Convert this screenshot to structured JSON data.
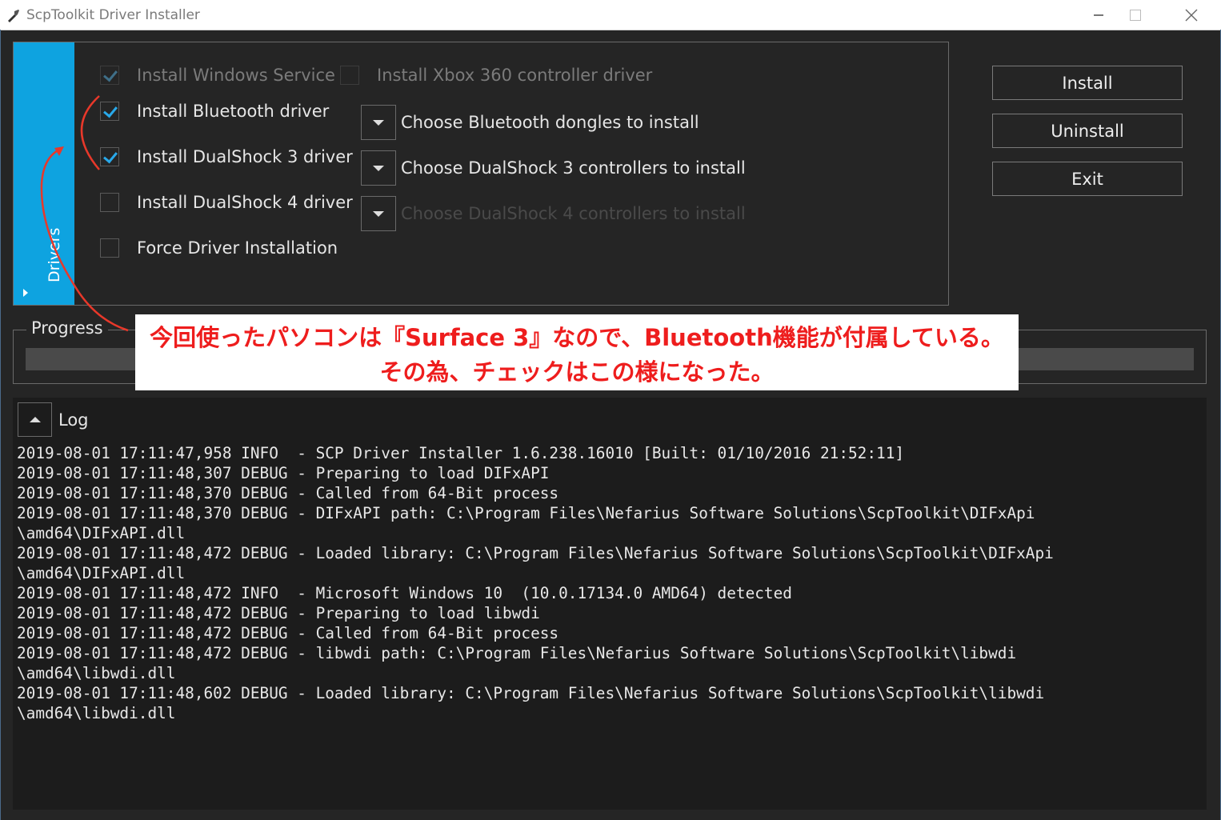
{
  "window": {
    "title": "ScpToolkit Driver Installer",
    "accent": "#0ea3e0"
  },
  "drivers": {
    "tab_label": "Drivers",
    "checkboxes": [
      {
        "label": "Install Windows Service",
        "checked": true,
        "enabled": false
      },
      {
        "label": "Install Xbox 360 controller driver",
        "checked": false,
        "enabled": false
      },
      {
        "label": "Install Bluetooth driver",
        "checked": true,
        "enabled": true
      },
      {
        "label": "Install DualShock 3 driver",
        "checked": true,
        "enabled": true
      },
      {
        "label": "Install DualShock 4 driver",
        "checked": false,
        "enabled": true
      },
      {
        "label": "Force Driver Installation",
        "checked": false,
        "enabled": true
      }
    ],
    "dropdowns": [
      {
        "label": "Choose Bluetooth dongles to install",
        "enabled": true
      },
      {
        "label": "Choose DualShock 3 controllers to install",
        "enabled": true
      },
      {
        "label": "Choose DualShock 4 controllers to install",
        "enabled": false
      }
    ]
  },
  "actions": {
    "install": "Install",
    "uninstall": "Uninstall",
    "exit": "Exit"
  },
  "progress": {
    "label": "Progress",
    "value": 0
  },
  "log": {
    "title": "Log",
    "lines": [
      "2019-08-01 17:11:47,958 INFO  - SCP Driver Installer 1.6.238.16010 [Built: 01/10/2016 21:52:11]",
      "2019-08-01 17:11:48,307 DEBUG - Preparing to load DIFxAPI",
      "2019-08-01 17:11:48,370 DEBUG - Called from 64-Bit process",
      "2019-08-01 17:11:48,370 DEBUG - DIFxAPI path: C:\\Program Files\\Nefarius Software Solutions\\ScpToolkit\\DIFxApi",
      "\\amd64\\DIFxAPI.dll",
      "2019-08-01 17:11:48,472 DEBUG - Loaded library: C:\\Program Files\\Nefarius Software Solutions\\ScpToolkit\\DIFxApi",
      "\\amd64\\DIFxAPI.dll",
      "2019-08-01 17:11:48,472 INFO  - Microsoft Windows 10  (10.0.17134.0 AMD64) detected",
      "2019-08-01 17:11:48,472 DEBUG - Preparing to load libwdi",
      "2019-08-01 17:11:48,472 DEBUG - Called from 64-Bit process",
      "2019-08-01 17:11:48,472 DEBUG - libwdi path: C:\\Program Files\\Nefarius Software Solutions\\ScpToolkit\\libwdi",
      "\\amd64\\libwdi.dll",
      "2019-08-01 17:11:48,602 DEBUG - Loaded library: C:\\Program Files\\Nefarius Software Solutions\\ScpToolkit\\libwdi",
      "\\amd64\\libwdi.dll"
    ]
  },
  "annotation": {
    "line1": "今回使ったパソコンは『Surface 3』なので、Bluetooth機能が付属している。",
    "line2": "その為、チェックはこの様になった。",
    "color": "#ee1d1d"
  }
}
